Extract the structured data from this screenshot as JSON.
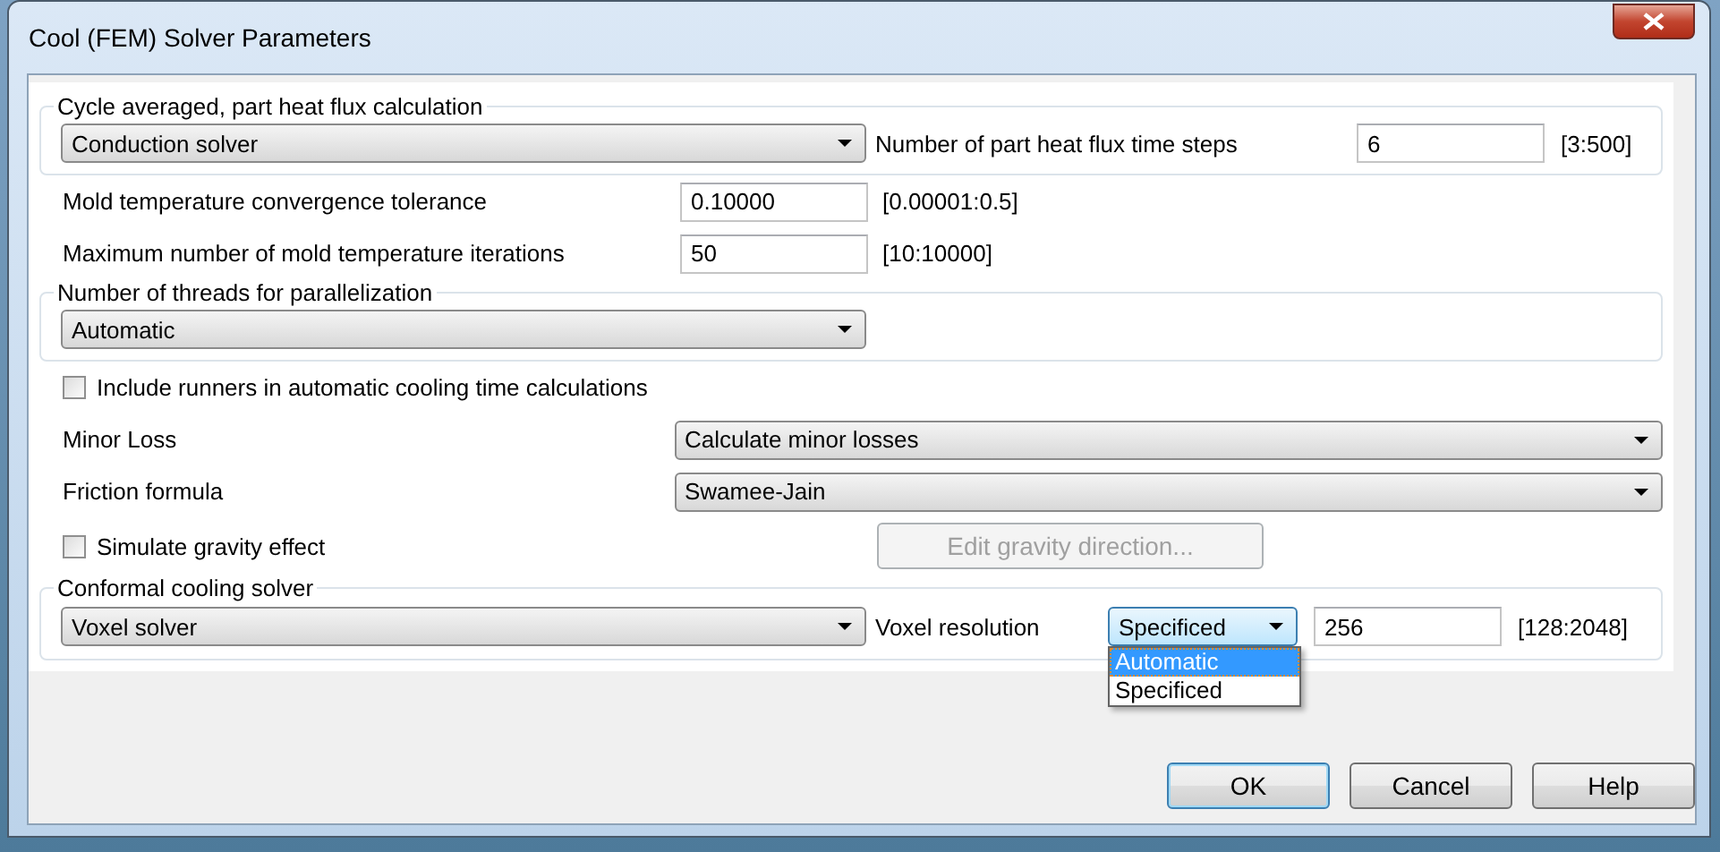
{
  "window": {
    "title": "Cool (FEM) Solver Parameters"
  },
  "heat_flux_group": {
    "legend": "Cycle averaged, part heat flux calculation",
    "solver": "Conduction solver",
    "time_steps": {
      "label": "Number of part heat flux time steps",
      "value": "6",
      "range": "[3:500]"
    }
  },
  "fields": [
    {
      "label": "Mold temperature convergence tolerance",
      "value": "0.10000",
      "range": "[0.00001:0.5]"
    },
    {
      "label": "Maximum number of mold temperature iterations",
      "value": "50",
      "range": "[10:10000]"
    }
  ],
  "threads_group": {
    "legend": "Number of threads for parallelization",
    "value": "Automatic"
  },
  "include_runners": {
    "label": "Include runners in automatic cooling time calculations",
    "checked": false
  },
  "combo_rows": [
    {
      "label": "Minor Loss",
      "value": "Calculate minor losses"
    },
    {
      "label": "Friction formula",
      "value": "Swamee-Jain"
    }
  ],
  "gravity": {
    "label": "Simulate gravity effect",
    "checked": false
  },
  "edit_gravity_button": {
    "label": "Edit gravity direction...",
    "disabled": true
  },
  "conformal_group": {
    "legend": "Conformal cooling solver",
    "solver": "Voxel solver",
    "resolution_label": "Voxel resolution",
    "resolution_mode": {
      "value": "Specificed",
      "expanded": true,
      "options": [
        {
          "label": "Automatic",
          "highlighted": true
        },
        {
          "label": "Specificed",
          "highlighted": false
        }
      ]
    },
    "resolution_value": "256",
    "range": "[128:2048]"
  },
  "buttons": [
    {
      "label": "OK",
      "default": true
    },
    {
      "label": "Cancel",
      "default": false
    },
    {
      "label": "Help",
      "default": false
    }
  ]
}
